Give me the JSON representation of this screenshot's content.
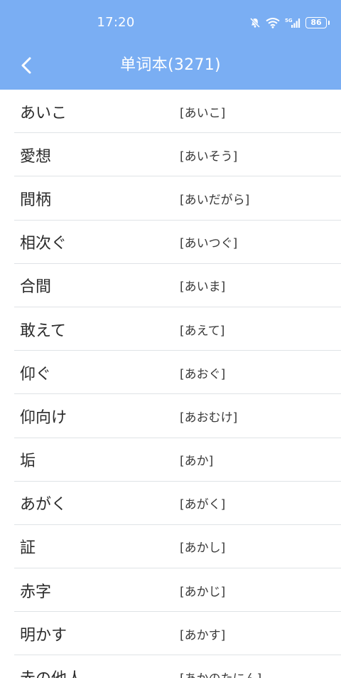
{
  "status_bar": {
    "time": "17:20",
    "battery": "86",
    "icons": [
      "mute-bell-icon",
      "wifi-icon",
      "5g-signal-icon",
      "battery-icon"
    ]
  },
  "header": {
    "title": "单词本(3271)",
    "back_icon": "chevron-left-icon",
    "background": "#7aaef3"
  },
  "words": [
    {
      "word": "あいこ",
      "reading": "[あいこ]"
    },
    {
      "word": "愛想",
      "reading": "[あいそう]"
    },
    {
      "word": "間柄",
      "reading": "[あいだがら]"
    },
    {
      "word": "相次ぐ",
      "reading": "[あいつぐ]"
    },
    {
      "word": "合間",
      "reading": "[あいま]"
    },
    {
      "word": "敢えて",
      "reading": "[あえて]"
    },
    {
      "word": "仰ぐ",
      "reading": "[あおぐ]"
    },
    {
      "word": "仰向け",
      "reading": "[あおむけ]"
    },
    {
      "word": "垢",
      "reading": "[あか]"
    },
    {
      "word": "あがく",
      "reading": "[あがく]"
    },
    {
      "word": "証",
      "reading": "[あかし]"
    },
    {
      "word": "赤字",
      "reading": "[あかじ]"
    },
    {
      "word": "明かす",
      "reading": "[あかす]"
    },
    {
      "word": "赤の他人",
      "reading": "[あかのたにん]"
    }
  ]
}
